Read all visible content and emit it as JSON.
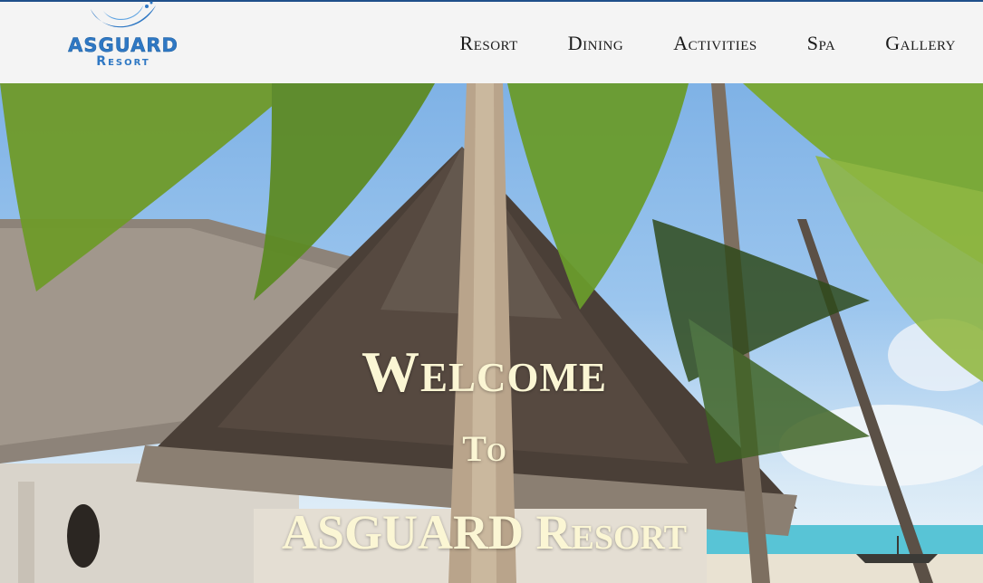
{
  "brand": {
    "name": "ASGUARD",
    "subtitle": "Resort",
    "color": "#2f78c4"
  },
  "nav": {
    "items": [
      {
        "label": "Resort"
      },
      {
        "label": "Dining"
      },
      {
        "label": "Activities"
      },
      {
        "label": "Spa"
      },
      {
        "label": "Gallery"
      }
    ]
  },
  "hero": {
    "line1": "Welcome",
    "line2": "To",
    "line3": "ASGUARD Resort",
    "text_color": "#fbf6d4"
  }
}
